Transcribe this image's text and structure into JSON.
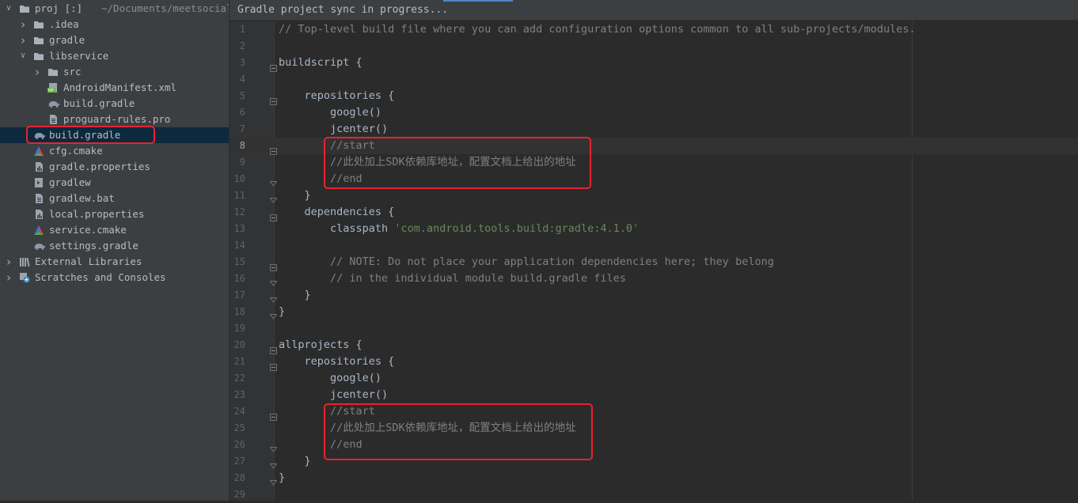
{
  "sidebar": {
    "root": {
      "name": "proj [:]",
      "path": "~/Documents/meetsocial"
    },
    "items": [
      {
        "label": "proj [:]",
        "icon": "folder-icon",
        "depth": 0,
        "arrow": "open"
      },
      {
        "label": ".idea",
        "icon": "folder-icon",
        "depth": 1,
        "arrow": "closed"
      },
      {
        "label": "gradle",
        "icon": "folder-icon",
        "depth": 1,
        "arrow": "closed"
      },
      {
        "label": "libservice",
        "icon": "folder-icon",
        "depth": 1,
        "arrow": "open"
      },
      {
        "label": "src",
        "icon": "folder-icon",
        "depth": 2,
        "arrow": "closed"
      },
      {
        "label": "AndroidManifest.xml",
        "icon": "manifest-icon",
        "depth": 2,
        "arrow": "none"
      },
      {
        "label": "build.gradle",
        "icon": "gradle-elephant-icon",
        "depth": 2,
        "arrow": "none"
      },
      {
        "label": "proguard-rules.pro",
        "icon": "text-file-icon",
        "depth": 2,
        "arrow": "none"
      },
      {
        "label": "build.gradle",
        "icon": "gradle-elephant-icon",
        "depth": 1,
        "arrow": "none",
        "selected": true
      },
      {
        "label": "cfg.cmake",
        "icon": "cmake-icon",
        "depth": 1,
        "arrow": "none"
      },
      {
        "label": "gradle.properties",
        "icon": "properties-icon",
        "depth": 1,
        "arrow": "none"
      },
      {
        "label": "gradlew",
        "icon": "script-icon",
        "depth": 1,
        "arrow": "none"
      },
      {
        "label": "gradlew.bat",
        "icon": "text-file-icon",
        "depth": 1,
        "arrow": "none"
      },
      {
        "label": "local.properties",
        "icon": "properties-icon",
        "depth": 1,
        "arrow": "none"
      },
      {
        "label": "service.cmake",
        "icon": "cmake-icon",
        "depth": 1,
        "arrow": "none"
      },
      {
        "label": "settings.gradle",
        "icon": "gradle-elephant-icon",
        "depth": 1,
        "arrow": "none"
      },
      {
        "label": "External Libraries",
        "icon": "libraries-icon",
        "depth": 0,
        "arrow": "closed"
      },
      {
        "label": "Scratches and Consoles",
        "icon": "scratches-icon",
        "depth": 0,
        "arrow": "closed"
      }
    ]
  },
  "editor": {
    "notification": "Gradle project sync in progress...",
    "current_line": 8,
    "lines": [
      {
        "n": "1",
        "segments": [
          {
            "t": "// Top-level build file where you can add configuration options common to all sub-projects/modules.",
            "k": "comment"
          }
        ]
      },
      {
        "n": "2",
        "segments": []
      },
      {
        "n": "3",
        "segments": [
          {
            "t": "buildscript {",
            "k": "plain"
          }
        ],
        "fold": "open"
      },
      {
        "n": "4",
        "segments": []
      },
      {
        "n": "5",
        "segments": [
          {
            "t": "    repositories {",
            "k": "plain"
          }
        ],
        "fold": "open"
      },
      {
        "n": "6",
        "segments": [
          {
            "t": "        google()",
            "k": "plain"
          }
        ]
      },
      {
        "n": "7",
        "segments": [
          {
            "t": "        jcenter()",
            "k": "plain"
          }
        ]
      },
      {
        "n": "8",
        "segments": [
          {
            "t": "        //start",
            "k": "comment"
          }
        ],
        "fold": "open"
      },
      {
        "n": "9",
        "segments": [
          {
            "t": "        //此处加上SDK依赖库地址，配置文档上给出的地址",
            "k": "comment"
          }
        ]
      },
      {
        "n": "10",
        "segments": [
          {
            "t": "        //end",
            "k": "comment"
          }
        ],
        "fold": "close"
      },
      {
        "n": "11",
        "segments": [
          {
            "t": "    }",
            "k": "plain"
          }
        ],
        "fold": "close"
      },
      {
        "n": "12",
        "segments": [
          {
            "t": "    dependencies {",
            "k": "plain"
          }
        ],
        "fold": "open"
      },
      {
        "n": "13",
        "segments": [
          {
            "t": "        classpath ",
            "k": "plain"
          },
          {
            "t": "'com.android.tools.build:gradle:4.1.0'",
            "k": "string"
          }
        ]
      },
      {
        "n": "14",
        "segments": []
      },
      {
        "n": "15",
        "segments": [
          {
            "t": "        // NOTE: Do not place your application dependencies here; they belong",
            "k": "comment"
          }
        ],
        "fold": "open"
      },
      {
        "n": "16",
        "segments": [
          {
            "t": "        // in the individual module build.gradle files",
            "k": "comment"
          }
        ],
        "fold": "close"
      },
      {
        "n": "17",
        "segments": [
          {
            "t": "    }",
            "k": "plain"
          }
        ],
        "fold": "close"
      },
      {
        "n": "18",
        "segments": [
          {
            "t": "}",
            "k": "plain"
          }
        ],
        "fold": "close"
      },
      {
        "n": "19",
        "segments": []
      },
      {
        "n": "20",
        "segments": [
          {
            "t": "allprojects {",
            "k": "plain"
          }
        ],
        "fold": "open"
      },
      {
        "n": "21",
        "segments": [
          {
            "t": "    repositories {",
            "k": "plain"
          }
        ],
        "fold": "open"
      },
      {
        "n": "22",
        "segments": [
          {
            "t": "        google()",
            "k": "plain"
          }
        ]
      },
      {
        "n": "23",
        "segments": [
          {
            "t": "        jcenter()",
            "k": "plain"
          }
        ]
      },
      {
        "n": "24",
        "segments": [
          {
            "t": "        //start",
            "k": "comment"
          }
        ],
        "fold": "open"
      },
      {
        "n": "25",
        "segments": [
          {
            "t": "        //此处加上SDK依赖库地址，配置文档上给出的地址",
            "k": "comment"
          }
        ]
      },
      {
        "n": "26",
        "segments": [
          {
            "t": "        //end",
            "k": "comment"
          }
        ],
        "fold": "close"
      },
      {
        "n": "27",
        "segments": [
          {
            "t": "    }",
            "k": "plain"
          }
        ],
        "fold": "close"
      },
      {
        "n": "28",
        "segments": [
          {
            "t": "}",
            "k": "plain"
          }
        ],
        "fold": "close"
      },
      {
        "n": "29",
        "segments": []
      }
    ]
  },
  "colors": {
    "sidebar_bg": "#3c3f41",
    "editor_bg": "#2b2b2b",
    "selection": "#0d293e",
    "annotation_red": "#e8232f",
    "comment": "#808080",
    "string": "#6a8759",
    "plain": "#a9b7c6"
  }
}
